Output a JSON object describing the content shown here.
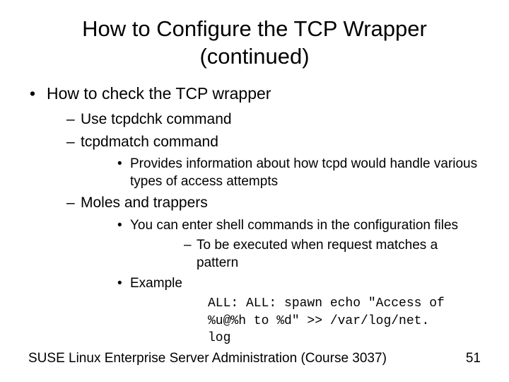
{
  "title_line1": "How to Configure the TCP Wrapper",
  "title_line2": "(continued)",
  "b1": "How to check the TCP wrapper",
  "b1_1": "Use tcpdchk command",
  "b1_2": "tcpdmatch command",
  "b1_2_1": "Provides information about how tcpd would handle various types of access attempts",
  "b1_3": "Moles and trappers",
  "b1_3_1": "You can enter shell commands in the configuration files",
  "b1_3_1_1": "To be executed when request matches a pattern",
  "b1_3_2": "Example",
  "code": "ALL: ALL: spawn echo \"Access of %u@%h to %d\" >> /var/log/net. log",
  "footer_text": "SUSE Linux Enterprise Server Administration (Course 3037)",
  "page_number": "51"
}
